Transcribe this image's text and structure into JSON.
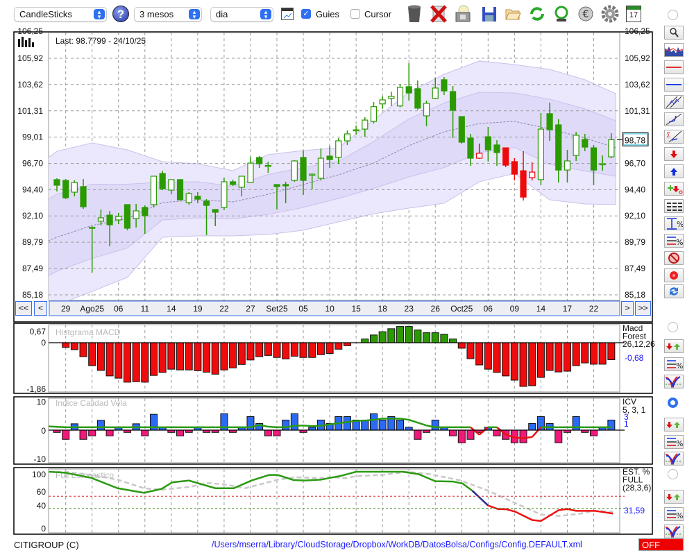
{
  "toolbar": {
    "chart_type": "CandleSticks",
    "period": "3 mesos",
    "interval": "dia",
    "guides_label": "Guies",
    "guides_checked": true,
    "cursor_label": "Cursor",
    "cursor_checked": false,
    "calendar_day": "17"
  },
  "main": {
    "last_label": "Last: 98.7799 - 24/10/25",
    "nav": {
      "first": "<<",
      "prev": "<",
      "next": ">",
      "last": ">>"
    }
  },
  "status": {
    "ticker": "CITIGROUP (C)",
    "config_path": "/Users/mserra/Library/CloudStorage/Dropbox/WorkDB/DatosBolsa/Configs/Config.DEFAULT.xml",
    "off_label": "OFF"
  },
  "colors": {
    "up_candle": "#ffffff",
    "candle_green": "#2a9a00",
    "candle_red": "#ee0a0a",
    "band_outer": "#ebe7fc",
    "band_inner": "#e0daf9",
    "accent_blue": "#1a1aff",
    "macd_neg": "#f00c0c",
    "icv_pos": "#2a6af5",
    "icv_neg": "#f0197a"
  },
  "chart_data": [
    {
      "type": "candlestick",
      "ylim": [
        85.18,
        106.25
      ],
      "y_tick_values": [
        106.25,
        105.92,
        103.62,
        101.31,
        99.01,
        96.7,
        94.4,
        92.1,
        89.79,
        87.49,
        85.18
      ],
      "y_tick_labels": [
        "106,25",
        "105,92",
        "103,62",
        "101,31",
        "99,01",
        "96,70",
        "94,40",
        "92,10",
        "89,79",
        "87,49",
        "85,18"
      ],
      "x_tick_start": 1,
      "x_tick_step": 3,
      "x_tick_labels": [
        "29",
        "Ago25",
        "06",
        "11",
        "14",
        "19",
        "22",
        "27",
        "Set25",
        "05",
        "10",
        "15",
        "18",
        "23",
        "26",
        "Oct25",
        "06",
        "09",
        "14",
        "17",
        "22"
      ],
      "last_price_label": "98,78",
      "last_price": 98.78,
      "red_indices": [
        48,
        51,
        52,
        53,
        54
      ],
      "ohlc": [
        [
          95.28,
          95.4,
          94.24,
          94.79
        ],
        [
          95.21,
          95.33,
          93.57,
          93.69
        ],
        [
          94.18,
          95.21,
          93.82,
          95.03
        ],
        [
          94.67,
          95.33,
          92.72,
          92.9
        ],
        [
          91.08,
          91.2,
          87.12,
          91.1
        ],
        [
          91.63,
          92.66,
          91.26,
          91.93
        ],
        [
          92.17,
          92.54,
          89.44,
          91.32
        ],
        [
          91.75,
          92.36,
          91.38,
          92.05
        ],
        [
          93.09,
          93.09,
          90.84,
          91.02
        ],
        [
          91.87,
          93.15,
          91.08,
          92.54
        ],
        [
          92.84,
          93.02,
          90.53,
          92.11
        ],
        [
          93.09,
          95.58,
          92.84,
          95.58
        ],
        [
          95.82,
          96.06,
          94.36,
          94.48
        ],
        [
          94.36,
          95.28,
          93.99,
          95.28
        ],
        [
          95.28,
          95.33,
          93.45,
          93.51
        ],
        [
          93.27,
          94.18,
          93.09,
          94.06
        ],
        [
          93.82,
          94.18,
          93.21,
          93.57
        ],
        [
          93.39,
          93.57,
          90.41,
          93.02
        ],
        [
          92.66,
          92.66,
          91.2,
          92.42
        ],
        [
          92.84,
          95.46,
          92.6,
          95.09
        ],
        [
          95.09,
          95.28,
          94.73,
          94.85
        ],
        [
          94.61,
          95.58,
          93.82,
          95.58
        ],
        [
          95.03,
          97.28,
          95.03,
          96.73
        ],
        [
          97.22,
          97.34,
          96.31,
          96.67
        ],
        [
          96.49,
          96.86,
          95.88,
          96.52
        ],
        [
          94.85,
          94.85,
          92.66,
          94.67
        ],
        [
          94.85,
          95.09,
          93.21,
          94.73
        ],
        [
          95.21,
          96.98,
          95.09,
          96.92
        ],
        [
          97.22,
          97.83,
          93.94,
          95.21
        ],
        [
          95.7,
          95.82,
          94.42,
          95.76
        ],
        [
          95.4,
          98.01,
          95.21,
          97.16
        ],
        [
          97.34,
          98.26,
          96.31,
          97.04
        ],
        [
          97.22,
          98.92,
          96.67,
          98.68
        ],
        [
          98.68,
          99.59,
          98.32,
          99.29
        ],
        [
          99.59,
          100.02,
          99.23,
          99.65
        ],
        [
          99.71,
          100.75,
          99.04,
          100.5
        ],
        [
          100.38,
          102.09,
          100.2,
          101.68
        ],
        [
          101.92,
          102.58,
          101.49,
          102.27
        ],
        [
          102.4,
          103.0,
          101.74,
          102.58
        ],
        [
          101.74,
          103.67,
          101.62,
          103.37
        ],
        [
          103.43,
          105.49,
          102.21,
          102.88
        ],
        [
          103.25,
          103.97,
          101.42,
          101.55
        ],
        [
          100.87,
          102.21,
          99.96,
          101.97
        ],
        [
          102.4,
          104.22,
          102.33,
          103.31
        ],
        [
          104.04,
          104.28,
          102.7,
          103.06
        ],
        [
          103.0,
          103.49,
          98.92,
          101.36
        ],
        [
          100.81,
          100.81,
          98.44,
          98.56
        ],
        [
          98.92,
          99.29,
          96.49,
          97.16
        ],
        [
          97.16,
          98.44,
          97.1,
          97.59
        ],
        [
          99.04,
          99.9,
          96.86,
          97.89
        ],
        [
          98.32,
          98.74,
          96.49,
          97.65
        ],
        [
          98.07,
          98.07,
          96.37,
          96.55
        ],
        [
          96.86,
          97.16,
          95.21,
          95.76
        ],
        [
          96.06,
          97.77,
          93.45,
          93.75
        ],
        [
          95.46,
          96.8,
          95.21,
          95.94
        ],
        [
          95.28,
          101.12,
          94.79,
          99.71
        ],
        [
          101.06,
          102.03,
          98.68,
          99.65
        ],
        [
          100.08,
          100.57,
          95.03,
          96.12
        ],
        [
          96.12,
          97.89,
          95.03,
          96.92
        ],
        [
          97.4,
          99.47,
          96.92,
          99.17
        ],
        [
          98.8,
          99.29,
          97.77,
          98.13
        ],
        [
          98.07,
          98.32,
          94.79,
          96.12
        ],
        [
          96.61,
          97.4,
          96.06,
          96.67
        ],
        [
          97.28,
          99.35,
          97.16,
          98.78
        ]
      ],
      "bollinger": {
        "anchor_index": [
          -1,
          0,
          4,
          8,
          12,
          16,
          20,
          24,
          28,
          32,
          36,
          40,
          44,
          48,
          52,
          56,
          60,
          63.5
        ],
        "upper": [
          97.2,
          97.77,
          98.5,
          97.89,
          96.86,
          96.67,
          96.07,
          97.47,
          97.83,
          98.07,
          100.51,
          102.94,
          104.52,
          105.68,
          105.37,
          104.95,
          104.04,
          102.82
        ],
        "middle": [
          89.9,
          90.23,
          91.26,
          91.87,
          93.27,
          93.51,
          93.33,
          93.99,
          94.85,
          95.7,
          96.74,
          98.26,
          99.47,
          100.2,
          100.39,
          99.72,
          98.93,
          98.07
        ],
        "lower": [
          83.8,
          84.27,
          85.48,
          86.7,
          90.23,
          90.35,
          90.35,
          90.47,
          90.84,
          91.57,
          92.29,
          92.78,
          93.21,
          95.09,
          95.82,
          93.51,
          93.15,
          93.09
        ]
      }
    },
    {
      "type": "bar",
      "title": "Histgrama MACD",
      "ylim": [
        -1.86,
        0.67
      ],
      "y_tick_values": [
        0.67,
        0,
        -1.86
      ],
      "y_tick_labels": [
        "0,67",
        "0",
        "-1,86"
      ],
      "legend": [
        "Macd",
        "Forest",
        "26,12,26"
      ],
      "value_label": "-0,68",
      "values": [
        0,
        -0.19,
        -0.28,
        -0.56,
        -0.92,
        -1.11,
        -1.33,
        -1.42,
        -1.58,
        -1.56,
        -1.58,
        -1.31,
        -1.19,
        -1.06,
        -1.09,
        -1.09,
        -1.12,
        -1.18,
        -1.26,
        -1.09,
        -1.01,
        -0.87,
        -0.69,
        -0.56,
        -0.51,
        -0.59,
        -0.65,
        -0.54,
        -0.59,
        -0.59,
        -0.48,
        -0.43,
        -0.26,
        -0.12,
        0,
        0.15,
        0.31,
        0.44,
        0.56,
        0.65,
        0.65,
        0.51,
        0.4,
        0.4,
        0.34,
        0.15,
        -0.22,
        -0.64,
        -0.89,
        -1.06,
        -1.19,
        -1.33,
        -1.5,
        -1.75,
        -1.72,
        -1.39,
        -1.11,
        -1.17,
        -1.14,
        -0.92,
        -0.81,
        -0.86,
        -0.86,
        -0.68
      ]
    },
    {
      "type": "bar",
      "title": "Indice Calidad Vela",
      "ylim": [
        -10,
        10
      ],
      "y_tick_values": [
        10,
        0,
        -10
      ],
      "y_tick_labels": [
        "10",
        "0",
        "-10"
      ],
      "legend": [
        "ICV",
        "5, 3, 1"
      ],
      "value_labels": [
        "3",
        "1"
      ],
      "bars": [
        -0.8,
        -3.2,
        2.2,
        -3.2,
        -2,
        3.4,
        -2,
        1,
        -0.8,
        2.2,
        -2,
        5.5,
        1,
        -0.8,
        -2,
        -0.8,
        1,
        -0.8,
        -0.8,
        5.7,
        -0.8,
        1,
        4.7,
        2.3,
        -2,
        -2,
        3.5,
        5.7,
        -0.8,
        1,
        3.5,
        2.3,
        4.7,
        4.7,
        3.5,
        3.5,
        5.7,
        3.5,
        4.7,
        3.5,
        1,
        -3.2,
        -0.8,
        3.5,
        1,
        -2,
        -4.4,
        -3.2,
        -0.8,
        1,
        -2,
        -3.2,
        -4.4,
        -4.4,
        2.3,
        4.7,
        2.3,
        -4.4,
        -0.8,
        4.7,
        -0.8,
        -2,
        1,
        3.5
      ],
      "line": [
        1.3,
        1,
        1,
        1,
        1,
        1,
        1,
        1,
        1,
        1,
        1,
        1,
        1,
        1,
        1,
        1,
        1,
        1,
        1,
        1,
        1,
        1,
        1,
        1.8,
        1.2,
        1,
        1,
        1.5,
        1.6,
        1.4,
        1.5,
        2.0,
        2.4,
        2.8,
        3.2,
        3.3,
        3.6,
        4.0,
        4.0,
        4.0,
        3.6,
        2.6,
        1.6,
        1,
        1,
        1,
        1,
        1,
        -1.6,
        1,
        1,
        -1.5,
        -2.6,
        -2.8,
        -2.4,
        1,
        1,
        1,
        1,
        1,
        1,
        1,
        1,
        1
      ]
    },
    {
      "type": "line",
      "title": "Full Estocastico",
      "ylim": [
        0,
        100
      ],
      "y_tick_values": [
        100,
        60,
        40,
        0
      ],
      "y_tick_labels": [
        "100",
        "60",
        "40",
        "0"
      ],
      "guides": [
        60,
        40
      ],
      "legend": [
        "EST. %",
        "FULL",
        "(28,3,6)"
      ],
      "value_label": "31,59",
      "k_blue_from": 47.2,
      "k_red_from": 49,
      "k": [
        [
          -0.9,
          100
        ],
        [
          0.9,
          98.5
        ],
        [
          3.9,
          90
        ],
        [
          6.9,
          73
        ],
        [
          9.9,
          65.5
        ],
        [
          11.9,
          72
        ],
        [
          13.1,
          82.6
        ],
        [
          15,
          85.6
        ],
        [
          18,
          73
        ],
        [
          20.1,
          73
        ],
        [
          22.1,
          85.6
        ],
        [
          24.1,
          94.7
        ],
        [
          25.1,
          94.7
        ],
        [
          26.9,
          86.4
        ],
        [
          28.2,
          85.6
        ],
        [
          30,
          87
        ],
        [
          31.4,
          91
        ],
        [
          32.2,
          93
        ],
        [
          34,
          100
        ],
        [
          36.4,
          100
        ],
        [
          39.3,
          100
        ],
        [
          41.1,
          96
        ],
        [
          43,
          84.5
        ],
        [
          45,
          84
        ],
        [
          46.1,
          80.7
        ],
        [
          47.2,
          69
        ],
        [
          49,
          44.7
        ],
        [
          50.1,
          39
        ],
        [
          51.1,
          38.5
        ],
        [
          52.1,
          34.5
        ],
        [
          54,
          21
        ],
        [
          55,
          19.3
        ],
        [
          57,
          37
        ],
        [
          58,
          39
        ],
        [
          59,
          36
        ],
        [
          61.1,
          36
        ],
        [
          63.2,
          31.59
        ]
      ],
      "d": [
        [
          -0.9,
          100
        ],
        [
          0.9,
          100
        ],
        [
          3.9,
          94.7
        ],
        [
          6.9,
          87
        ],
        [
          9.9,
          73
        ],
        [
          11.9,
          70.5
        ],
        [
          15,
          75
        ],
        [
          17.2,
          81.5
        ],
        [
          19.3,
          78.8
        ],
        [
          21.4,
          73
        ],
        [
          25.1,
          87
        ],
        [
          27.2,
          91
        ],
        [
          29.8,
          89.4
        ],
        [
          31.4,
          91
        ],
        [
          32.7,
          89.4
        ],
        [
          34,
          92.8
        ],
        [
          37.1,
          95
        ],
        [
          39.8,
          100
        ],
        [
          42.4,
          96
        ],
        [
          45.8,
          86
        ],
        [
          49,
          69
        ],
        [
          52.1,
          48.5
        ],
        [
          55,
          30
        ],
        [
          57.2,
          27.6
        ],
        [
          59.5,
          31.5
        ],
        [
          61.1,
          36
        ],
        [
          63.2,
          34.5
        ]
      ]
    }
  ]
}
